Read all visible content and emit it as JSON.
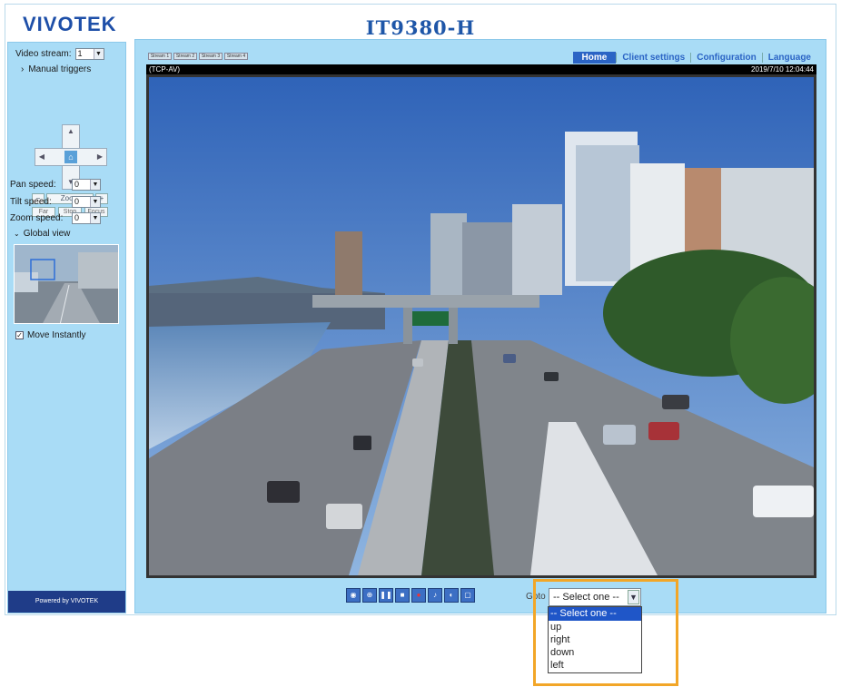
{
  "header": {
    "logo_text": "VIVOTEK",
    "product_name": "IT9380-H"
  },
  "sidebar": {
    "video_stream_label": "Video stream:",
    "video_stream_value": "1",
    "manual_triggers_label": "Manual triggers",
    "zoom_label": "Zoom",
    "focus_buttons": [
      "Far",
      "Stop",
      "Focus"
    ],
    "pan_speed_label": "Pan speed:",
    "pan_speed_value": "0",
    "tilt_speed_label": "Tilt speed:",
    "tilt_speed_value": "0",
    "zoom_speed_label": "Zoom speed:",
    "zoom_speed_value": "0",
    "global_view_label": "Global view",
    "move_instantly_label": "Move Instantly",
    "powered_by": "Powered by VIVOTEK"
  },
  "nav": {
    "home": "Home",
    "client_settings": "Client settings",
    "configuration": "Configuration",
    "language": "Language"
  },
  "stream_tabs": [
    "Stream 1",
    "Stream 2",
    "Stream 3",
    "Stream 4"
  ],
  "video": {
    "protocol": "(TCP-AV)",
    "timestamp": "2019/7/10 12:04:44"
  },
  "goto": {
    "label": "Goto",
    "selected": "-- Select one --",
    "options": [
      "-- Select one --",
      "up",
      "right",
      "down",
      "left"
    ]
  }
}
